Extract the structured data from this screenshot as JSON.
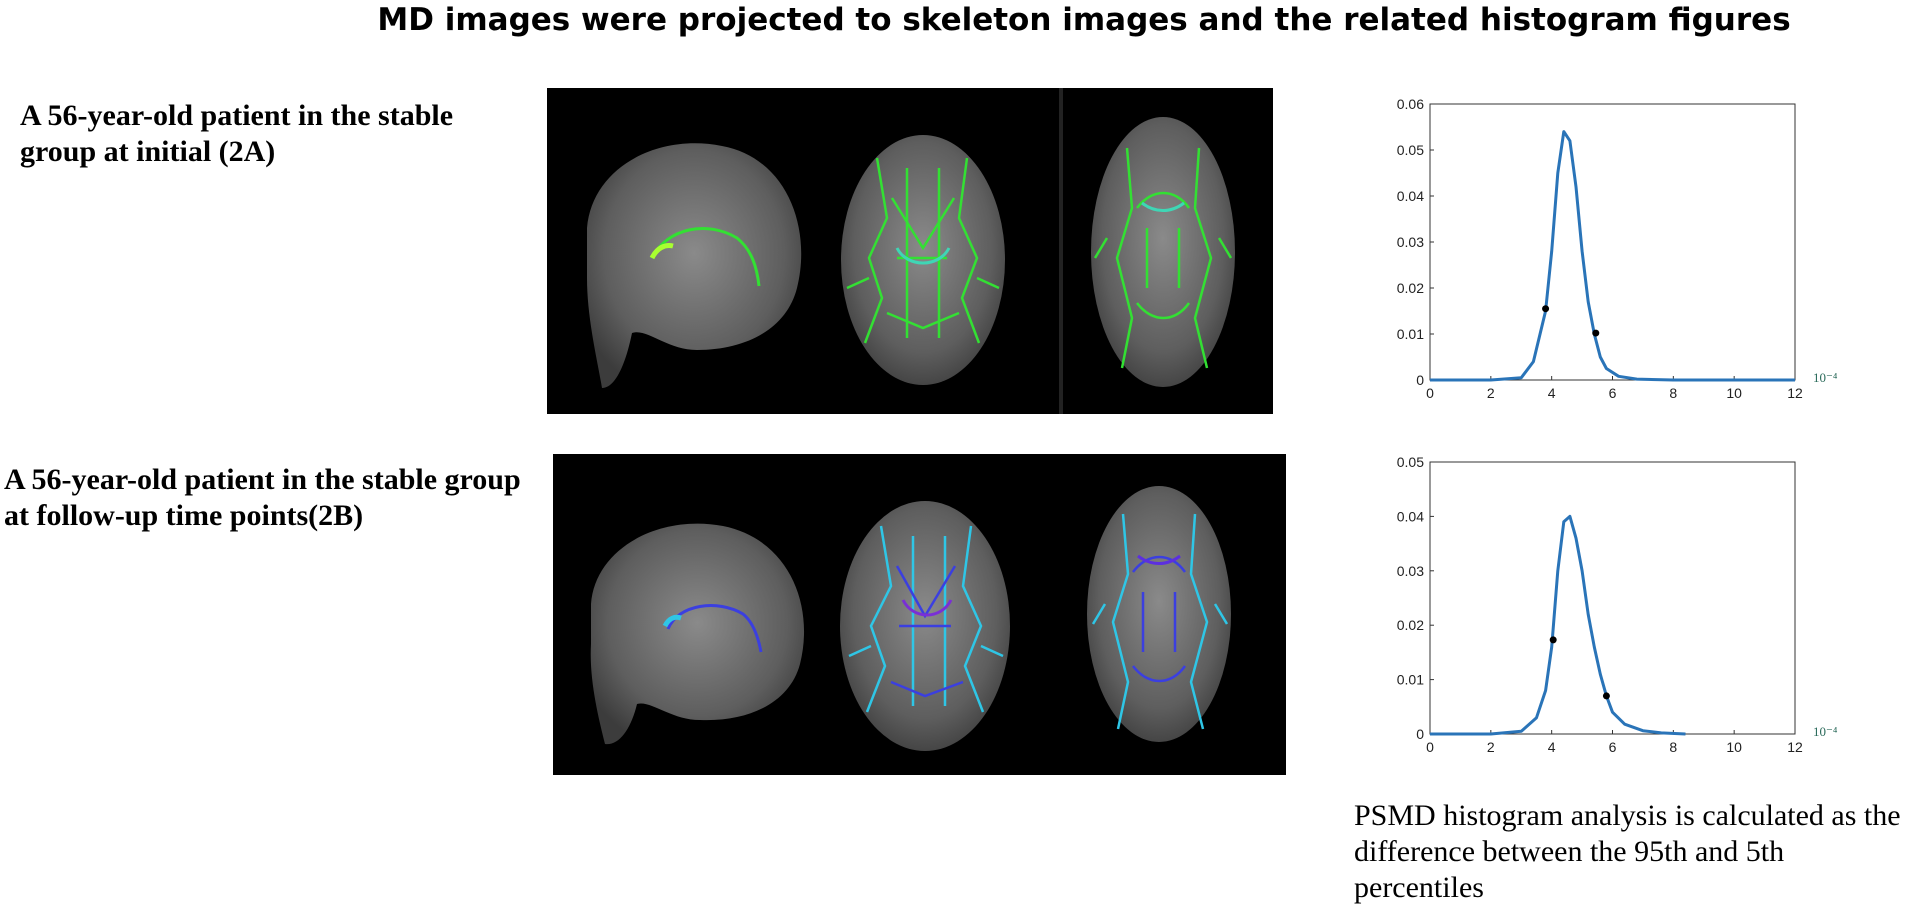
{
  "figure": {
    "title": "MD images were projected to skeleton images and the related histogram figures",
    "panel_a_label": "A 56-year-old patient in the stable group at initial (2A)",
    "panel_b_label": "A 56-year-old patient in the stable group at  follow-up time points(2B)",
    "caption": "PSMD histogram analysis  is calculated as the difference between the 95th and 5th percentiles",
    "colors": {
      "panel_a_skeleton": "#33e033",
      "panel_a_skeleton_alt": "#3fd6b5",
      "panel_b_skeleton": "#2fc6e6",
      "panel_b_skeleton_alt": "#3b3fe0",
      "curve": "#2a74b8"
    }
  },
  "chart_data": [
    {
      "type": "line",
      "name": "histogram-2A",
      "x_ticks": [
        "0",
        "2",
        "4",
        "6",
        "8",
        "10",
        "12"
      ],
      "y_ticks": [
        "0",
        "0.01",
        "0.02",
        "0.03",
        "0.04",
        "0.05",
        "0.06"
      ],
      "x_exponent_label": "10⁻⁴",
      "xlim": [
        0,
        12
      ],
      "ylim": [
        0,
        0.06
      ],
      "series": [
        {
          "x": [
            0,
            1,
            2,
            3,
            3.4,
            3.8,
            4.0,
            4.2,
            4.4,
            4.6,
            4.8,
            5.0,
            5.2,
            5.4,
            5.6,
            5.8,
            6.2,
            6.8,
            8,
            10,
            12
          ],
          "y": [
            0,
            0,
            0,
            0.0005,
            0.004,
            0.015,
            0.028,
            0.045,
            0.054,
            0.052,
            0.042,
            0.028,
            0.017,
            0.01,
            0.005,
            0.0025,
            0.0008,
            0.0002,
            0,
            0,
            0
          ]
        }
      ],
      "percentile_points": [
        {
          "x": 3.8,
          "y": 0.0155
        },
        {
          "x": 5.45,
          "y": 0.0102
        }
      ]
    },
    {
      "type": "line",
      "name": "histogram-2B",
      "x_ticks": [
        "0",
        "2",
        "4",
        "6",
        "8",
        "10",
        "12"
      ],
      "y_ticks": [
        "0",
        "0.01",
        "0.02",
        "0.03",
        "0.04",
        "0.05"
      ],
      "x_exponent_label": "10⁻⁴",
      "xlim": [
        0,
        12
      ],
      "ylim": [
        0,
        0.05
      ],
      "series": [
        {
          "x": [
            0,
            1,
            2,
            3,
            3.5,
            3.8,
            4.0,
            4.2,
            4.4,
            4.6,
            4.8,
            5.0,
            5.2,
            5.4,
            5.6,
            5.8,
            6.0,
            6.4,
            7.0,
            7.6,
            8.4
          ],
          "y": [
            0,
            0,
            0,
            0.0005,
            0.003,
            0.008,
            0.016,
            0.03,
            0.039,
            0.04,
            0.036,
            0.03,
            0.022,
            0.016,
            0.011,
            0.007,
            0.004,
            0.0018,
            0.0006,
            0.0002,
            0
          ]
        }
      ],
      "percentile_points": [
        {
          "x": 4.05,
          "y": 0.0173
        },
        {
          "x": 5.8,
          "y": 0.007
        }
      ]
    }
  ]
}
